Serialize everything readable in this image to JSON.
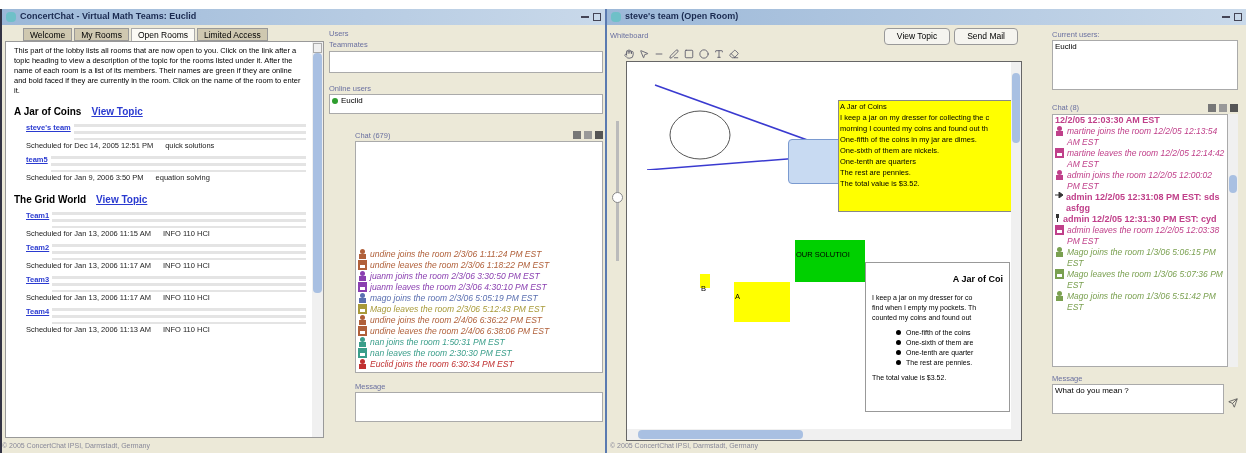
{
  "lobby_window": {
    "title": "ConcertChat - Virtual Math Teams: Euclid",
    "tabs": [
      {
        "label": "Welcome",
        "selected": false
      },
      {
        "label": "My Rooms",
        "selected": false
      },
      {
        "label": "Open Rooms",
        "selected": true
      },
      {
        "label": "Limited Access",
        "selected": false
      }
    ],
    "intro": "This part of the lobby lists all rooms that are now open to you. Click on the link after a topic heading to view a description of the topic for the rooms listed under it. After the name of each room is a list of its members. Their names are green if they are online and bold faced if they are currently in the room. Click on the name of the room to enter it.",
    "topics": [
      {
        "title": "A Jar of Coins",
        "link": "View Topic",
        "rooms": [
          {
            "name": "steve's team",
            "schedule": "Scheduled for Dec 14, 2005 12:51 PM",
            "subject": "quick solutions"
          },
          {
            "name": "team5",
            "schedule": "Scheduled for Jan 9, 2006 3:50 PM",
            "subject": "equation solving"
          }
        ]
      },
      {
        "title": "The Grid World",
        "link": "View Topic",
        "rooms": [
          {
            "name": "Team1",
            "schedule": "Scheduled for Jan 13, 2006 11:15 AM",
            "subject": "INFO 110 HCI"
          },
          {
            "name": "Team2",
            "schedule": "Scheduled for Jan 13, 2006 11:17 AM",
            "subject": "INFO 110 HCI"
          },
          {
            "name": "Team3",
            "schedule": "Scheduled for Jan 13, 2006 11:17 AM",
            "subject": "INFO 110 HCI"
          },
          {
            "name": "Team4",
            "schedule": "Scheduled for Jan 13, 2006 11:13 AM",
            "subject": "INFO 110 HCI"
          }
        ]
      }
    ],
    "users_label": "Users",
    "teammates_label": "Teammates",
    "online_label": "Online users",
    "online_users": [
      {
        "name": "Euclid",
        "color": "#2e9e2e"
      }
    ],
    "chat_label": "Chat (679)",
    "chat": [
      {
        "kind": "join",
        "text": "undine joins the room 2/3/06 1:11:24 PM EST",
        "color": "#b0603a"
      },
      {
        "kind": "leave",
        "text": "undine leaves the room 2/3/06 1:18:22 PM EST",
        "color": "#b0603a"
      },
      {
        "kind": "join",
        "text": "juanm joins the room 2/3/06 3:30:50 PM EST",
        "color": "#8a3fb0"
      },
      {
        "kind": "leave",
        "text": "juanm leaves the room 2/3/06 4:30:10 PM EST",
        "color": "#8a3fb0"
      },
      {
        "kind": "join",
        "text": "mago joins the room 2/3/06 5:05:19 PM EST",
        "color": "#5a6fb0"
      },
      {
        "kind": "leave",
        "text": "Mago leaves the room 2/3/06 5:12:43 PM EST",
        "color": "#a89a3a"
      },
      {
        "kind": "join",
        "text": "undine joins the room 2/4/06 6:36:22 PM EST",
        "color": "#b0603a"
      },
      {
        "kind": "leave",
        "text": "undine leaves the room 2/4/06 6:38:06 PM EST",
        "color": "#b0603a"
      },
      {
        "kind": "join",
        "text": "nan joins the room 1:50:31 PM EST",
        "color": "#3a9e8a"
      },
      {
        "kind": "leave",
        "text": "nan leaves the room 2:30:30 PM EST",
        "color": "#3a9e8a"
      },
      {
        "kind": "join",
        "text": "Euclid joins the room 6:30:34 PM EST",
        "color": "#c03030"
      }
    ],
    "message_label": "Message",
    "status": "© 2005 ConcertChat IPSI, Darmstadt, Germany"
  },
  "room_window": {
    "title": "steve's team (Open Room)",
    "whiteboard_label": "Whiteboard",
    "buttons": [
      "View Topic",
      "Send Mail"
    ],
    "note": {
      "lines": [
        "A Jar of Coins",
        "I keep a jar on my dresser for collecting the c",
        "morning I counted my coins and found out th",
        "One-fifth of the coins in my jar are dimes.",
        "One-sixth of them are nickels.",
        "One-tenth are quarters",
        "The rest are pennies.",
        "The total value is $3.52."
      ]
    },
    "labels": [
      {
        "text": "B"
      },
      {
        "text": "A"
      }
    ],
    "solution": "OUR SOLUTIOI",
    "zoom_slider": {
      "level": 0.45
    },
    "topic": {
      "title": "A Jar of Coi",
      "body": [
        "I keep a jar on my dresser for co",
        "find when I empty my pockets. Th",
        "counted my coins and found out"
      ],
      "bullets": [
        "One-fifth of the coins",
        "One-sixth of them are",
        "One-tenth are quarter",
        "The rest are pennies."
      ],
      "total": "The total value is $3.52."
    },
    "current_users_label": "Current users:",
    "current_users": [
      "Euclid"
    ],
    "chat_label": "Chat (8)",
    "chat": [
      {
        "kind": "time",
        "text": "12/2/05 12:03:30 AM EST",
        "color": "#c0408a"
      },
      {
        "kind": "join",
        "text": "martine joins the room 12/2/05 12:13:54 AM EST",
        "color": "#c0408a"
      },
      {
        "kind": "leave",
        "text": "martine leaves the room 12/2/05 12:14:42 AM EST",
        "color": "#c0408a"
      },
      {
        "kind": "join",
        "text": "admin joins the room 12/2/05 12:00:02 PM EST",
        "color": "#c0408a"
      },
      {
        "kind": "reference",
        "author": "admin",
        "text": "12/2/05 12:31:08 PM EST: sds asfgg",
        "color": "#c0408a"
      },
      {
        "kind": "message",
        "author": "admin",
        "text": "12/2/05 12:31:30 PM EST: cyd",
        "color": "#c0408a"
      },
      {
        "kind": "leave",
        "text": "admin leaves the room 12/2/05 12:03:38 PM EST",
        "color": "#c0408a"
      },
      {
        "kind": "join",
        "text": "Mago joins the room 1/3/06 5:06:15 PM EST",
        "color": "#7aa050"
      },
      {
        "kind": "leave",
        "text": "Mago leaves the room 1/3/06 5:07:36 PM EST",
        "color": "#7aa050"
      },
      {
        "kind": "join",
        "text": "Mago joins the room 1/3/06 5:51:42 PM EST",
        "color": "#7aa050"
      }
    ],
    "message_label": "Message",
    "message_value": "What do you mean ?",
    "status": "© 2005 ConcertChat IPSI, Darmstadt, Germany"
  }
}
